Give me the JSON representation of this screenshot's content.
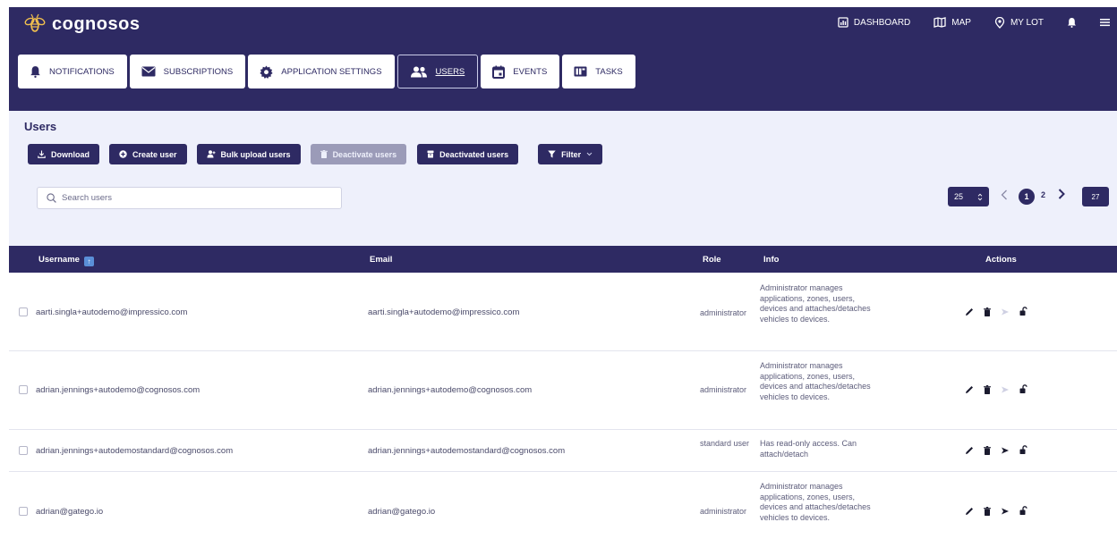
{
  "brand": {
    "name": "cognosos"
  },
  "topnav": [
    {
      "label": "DASHBOARD",
      "icon": "dashboard-icon"
    },
    {
      "label": "MAP",
      "icon": "map-icon"
    },
    {
      "label": "MY LOT",
      "icon": "location-pin-icon"
    },
    {
      "label": "",
      "icon": "bell-icon"
    },
    {
      "label": "",
      "icon": "hamburger-menu-icon"
    }
  ],
  "tabs": [
    {
      "label": "NOTIFICATIONS",
      "icon": "bell-icon"
    },
    {
      "label": "SUBSCRIPTIONS",
      "icon": "envelope-icon"
    },
    {
      "label": "APPLICATION SETTINGS",
      "icon": "gear-icon"
    },
    {
      "label": "USERS",
      "icon": "users-icon",
      "active": true
    },
    {
      "label": "EVENTS",
      "icon": "calendar-icon"
    },
    {
      "label": "TASKS",
      "icon": "tasks-icon"
    }
  ],
  "page": {
    "title": "Users"
  },
  "actions": {
    "download": "Download",
    "create_user": "Create user",
    "bulk_upload": "Bulk upload users",
    "deactivate": "Deactivate users",
    "deactivated": "Deactivated users",
    "filter": "Filter"
  },
  "search": {
    "placeholder": "Search users"
  },
  "pagination": {
    "per_page": "25",
    "current": "1",
    "next_page": "2",
    "total": "27"
  },
  "table": {
    "columns": {
      "username": "Username",
      "email": "Email",
      "role": "Role",
      "info": "Info",
      "actions": "Actions"
    },
    "rows": [
      {
        "username": "aarti.singla+autodemo@impressico.com",
        "email": "aarti.singla+autodemo@impressico.com",
        "role": "administrator",
        "info": "Administrator manages applications, zones, users, devices and attaches/detaches vehicles to devices.",
        "send_enabled": false
      },
      {
        "username": "adrian.jennings+autodemo@cognosos.com",
        "email": "adrian.jennings+autodemo@cognosos.com",
        "role": "administrator",
        "info": "Administrator manages applications, zones, users, devices and attaches/detaches vehicles to devices.",
        "send_enabled": false
      },
      {
        "username": "adrian.jennings+autodemostandard@cognosos.com",
        "email": "adrian.jennings+autodemostandard@cognosos.com",
        "role": "standard user",
        "info": "Has read-only access. Can attach/detach",
        "send_enabled": true
      },
      {
        "username": "adrian@gatego.io",
        "email": "adrian@gatego.io",
        "role": "administrator",
        "info": "Administrator manages applications, zones, users, devices and attaches/detaches vehicles to devices.",
        "send_enabled": true
      }
    ]
  },
  "colors": {
    "primary": "#2e2a63",
    "panel": "#eef0fb",
    "disabled": "#9b9bb8",
    "logo": "#f2c14e"
  }
}
